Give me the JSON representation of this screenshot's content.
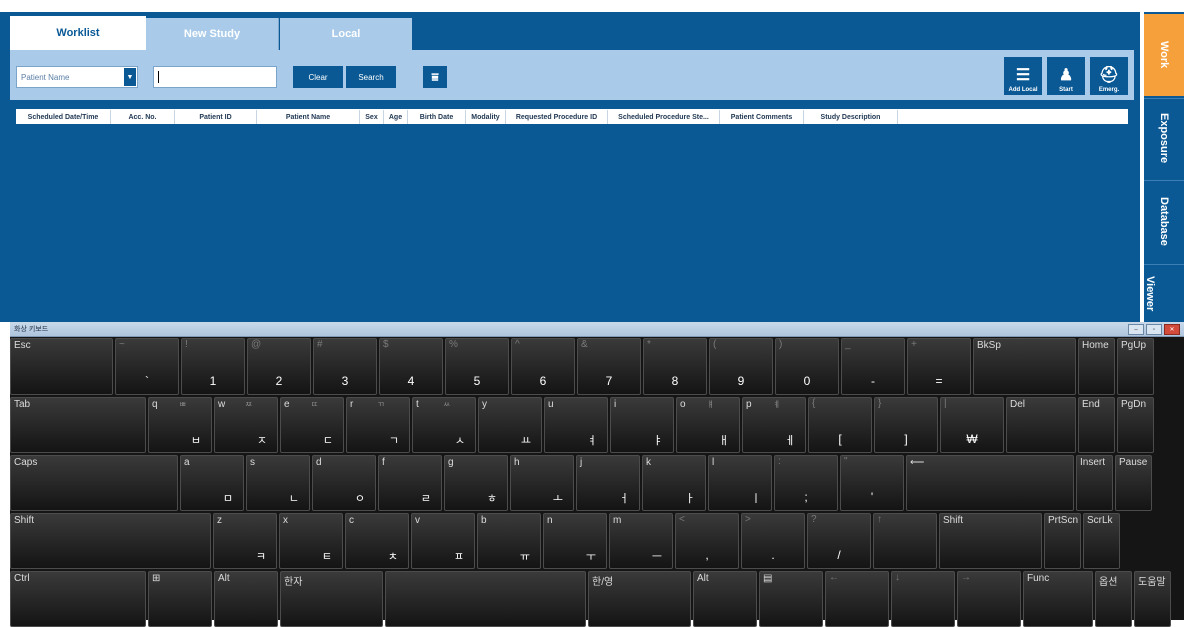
{
  "tabs": {
    "worklist": "Worklist",
    "new_study": "New Study",
    "local": "Local"
  },
  "toolbar": {
    "patient_field": "Patient Name",
    "clear": "Clear",
    "search": "Search",
    "add_local": "Add Local",
    "start": "Start",
    "emergency": "Emerg."
  },
  "grid": {
    "columns": [
      "Scheduled Date/Time",
      "Acc. No.",
      "Patient ID",
      "Patient Name",
      "Sex",
      "Age",
      "Birth Date",
      "Modality",
      "Requested Procedure ID",
      "Scheduled Procedure Ste...",
      "Patient Comments",
      "Study Description"
    ]
  },
  "nav": {
    "work": "Work",
    "exposure": "Exposure",
    "database": "Database",
    "viewer": "Viewer"
  },
  "keyboard": {
    "title": "화상 키보드",
    "row1": [
      {
        "top": "Esc",
        "main": ""
      },
      {
        "sym": "~",
        "main": "`"
      },
      {
        "sym": "!",
        "main": "1"
      },
      {
        "sym": "@",
        "main": "2"
      },
      {
        "sym": "#",
        "main": "3"
      },
      {
        "sym": "$",
        "main": "4"
      },
      {
        "sym": "%",
        "main": "5"
      },
      {
        "sym": "^",
        "main": "6"
      },
      {
        "sym": "&",
        "main": "7"
      },
      {
        "sym": "*",
        "main": "8"
      },
      {
        "sym": "(",
        "main": "9"
      },
      {
        "sym": ")",
        "main": "0"
      },
      {
        "sym": "_",
        "main": "-"
      },
      {
        "sym": "+",
        "main": "="
      },
      {
        "top": "BkSp",
        "main": ""
      },
      {
        "top": "Home",
        "main": ""
      },
      {
        "top": "PgUp",
        "main": ""
      }
    ],
    "row2": [
      {
        "top": "Tab",
        "main": ""
      },
      {
        "top": "q",
        "hint": "ㅃ",
        "main": "ㅂ"
      },
      {
        "top": "w",
        "hint": "ㅉ",
        "main": "ㅈ"
      },
      {
        "top": "e",
        "hint": "ㄸ",
        "main": "ㄷ"
      },
      {
        "top": "r",
        "hint": "ㄲ",
        "main": "ㄱ"
      },
      {
        "top": "t",
        "hint": "ㅆ",
        "main": "ㅅ"
      },
      {
        "top": "y",
        "main": "ㅛ"
      },
      {
        "top": "u",
        "main": "ㅕ"
      },
      {
        "top": "i",
        "main": "ㅑ"
      },
      {
        "top": "o",
        "hint": "ㅒ",
        "main": "ㅐ"
      },
      {
        "top": "p",
        "hint": "ㅖ",
        "main": "ㅔ"
      },
      {
        "sym": "{",
        "main": "["
      },
      {
        "sym": "}",
        "main": "]"
      },
      {
        "sym": "|",
        "main": "₩"
      },
      {
        "top": "Del",
        "main": ""
      },
      {
        "top": "End",
        "main": ""
      },
      {
        "top": "PgDn",
        "main": ""
      }
    ],
    "row3": [
      {
        "top": "Caps",
        "main": ""
      },
      {
        "top": "a",
        "main": "ㅁ"
      },
      {
        "top": "s",
        "main": "ㄴ"
      },
      {
        "top": "d",
        "main": "ㅇ"
      },
      {
        "top": "f",
        "main": "ㄹ"
      },
      {
        "top": "g",
        "main": "ㅎ"
      },
      {
        "top": "h",
        "main": "ㅗ"
      },
      {
        "top": "j",
        "main": "ㅓ"
      },
      {
        "top": "k",
        "main": "ㅏ"
      },
      {
        "top": "l",
        "main": "ㅣ"
      },
      {
        "sym": ":",
        "main": ";"
      },
      {
        "sym": "\"",
        "main": "'"
      },
      {
        "top": "⟵",
        "main": ""
      },
      {
        "top": "Insert",
        "main": ""
      },
      {
        "top": "Pause",
        "main": ""
      }
    ],
    "row4": [
      {
        "top": "Shift",
        "main": ""
      },
      {
        "top": "z",
        "main": "ㅋ"
      },
      {
        "top": "x",
        "main": "ㅌ"
      },
      {
        "top": "c",
        "main": "ㅊ"
      },
      {
        "top": "v",
        "main": "ㅍ"
      },
      {
        "top": "b",
        "main": "ㅠ"
      },
      {
        "top": "n",
        "main": "ㅜ"
      },
      {
        "top": "m",
        "main": "ㅡ"
      },
      {
        "sym": "<",
        "main": ","
      },
      {
        "sym": ">",
        "main": "."
      },
      {
        "sym": "?",
        "main": "/"
      },
      {
        "sym": "↑",
        "main": ""
      },
      {
        "top": "Shift",
        "main": ""
      },
      {
        "top": "PrtScn",
        "main": ""
      },
      {
        "top": "ScrLk",
        "main": ""
      }
    ],
    "row5": [
      {
        "top": "Ctrl",
        "main": ""
      },
      {
        "top": "⊞",
        "main": ""
      },
      {
        "top": "Alt",
        "main": ""
      },
      {
        "top": "한자",
        "main": ""
      },
      {
        "top": "",
        "main": ""
      },
      {
        "top": "한/영",
        "main": ""
      },
      {
        "top": "Alt",
        "main": ""
      },
      {
        "top": "▤",
        "main": ""
      },
      {
        "sym": "←",
        "main": ""
      },
      {
        "sym": "↓",
        "main": ""
      },
      {
        "sym": "→",
        "main": ""
      },
      {
        "top": "Func",
        "main": ""
      },
      {
        "top": "옵션",
        "main": ""
      },
      {
        "top": "도움말",
        "main": ""
      }
    ]
  }
}
